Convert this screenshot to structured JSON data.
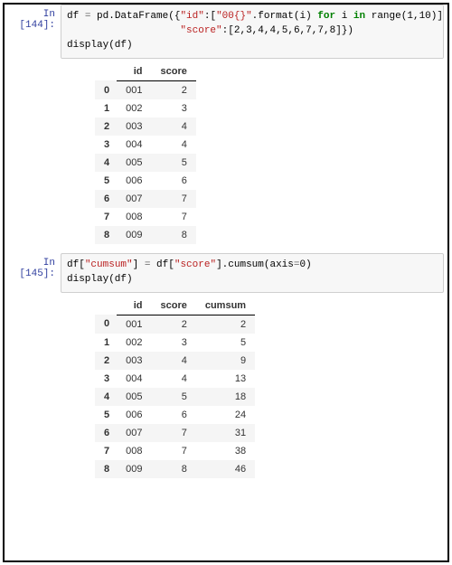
{
  "cells": [
    {
      "prompt_label": "In",
      "prompt_num": "[144]:",
      "code_html": "df <span class=\"tok-op\">=</span> pd.DataFrame({<span class=\"tok-str\">\"id\"</span>:[<span class=\"tok-str\">\"00{}\"</span>.format(i) <span class=\"tok-kw\">for</span> i <span class=\"tok-kw\">in</span> range(<span class=\"tok-num\">1</span>,<span class=\"tok-num\">10</span>)],\n                   <span class=\"tok-str\">\"score\"</span>:[<span class=\"tok-num\">2</span>,<span class=\"tok-num\">3</span>,<span class=\"tok-num\">4</span>,<span class=\"tok-num\">4</span>,<span class=\"tok-num\">5</span>,<span class=\"tok-num\">6</span>,<span class=\"tok-num\">7</span>,<span class=\"tok-num\">7</span>,<span class=\"tok-num\">8</span>]})\ndisplay(df)",
      "table": {
        "columns": [
          "id",
          "score"
        ],
        "rows": [
          {
            "idx": "0",
            "vals": [
              "001",
              "2"
            ]
          },
          {
            "idx": "1",
            "vals": [
              "002",
              "3"
            ]
          },
          {
            "idx": "2",
            "vals": [
              "003",
              "4"
            ]
          },
          {
            "idx": "3",
            "vals": [
              "004",
              "4"
            ]
          },
          {
            "idx": "4",
            "vals": [
              "005",
              "5"
            ]
          },
          {
            "idx": "5",
            "vals": [
              "006",
              "6"
            ]
          },
          {
            "idx": "6",
            "vals": [
              "007",
              "7"
            ]
          },
          {
            "idx": "7",
            "vals": [
              "008",
              "7"
            ]
          },
          {
            "idx": "8",
            "vals": [
              "009",
              "8"
            ]
          }
        ]
      }
    },
    {
      "prompt_label": "In",
      "prompt_num": "[145]:",
      "code_html": "df[<span class=\"tok-str\">\"cumsum\"</span>] <span class=\"tok-op\">=</span> df[<span class=\"tok-str\">\"score\"</span>].cumsum(axis<span class=\"tok-op\">=</span><span class=\"tok-num\">0</span>)\ndisplay(df)",
      "table": {
        "columns": [
          "id",
          "score",
          "cumsum"
        ],
        "rows": [
          {
            "idx": "0",
            "vals": [
              "001",
              "2",
              "2"
            ]
          },
          {
            "idx": "1",
            "vals": [
              "002",
              "3",
              "5"
            ]
          },
          {
            "idx": "2",
            "vals": [
              "003",
              "4",
              "9"
            ]
          },
          {
            "idx": "3",
            "vals": [
              "004",
              "4",
              "13"
            ]
          },
          {
            "idx": "4",
            "vals": [
              "005",
              "5",
              "18"
            ]
          },
          {
            "idx": "5",
            "vals": [
              "006",
              "6",
              "24"
            ]
          },
          {
            "idx": "6",
            "vals": [
              "007",
              "7",
              "31"
            ]
          },
          {
            "idx": "7",
            "vals": [
              "008",
              "7",
              "38"
            ]
          },
          {
            "idx": "8",
            "vals": [
              "009",
              "8",
              "46"
            ]
          }
        ]
      }
    }
  ]
}
